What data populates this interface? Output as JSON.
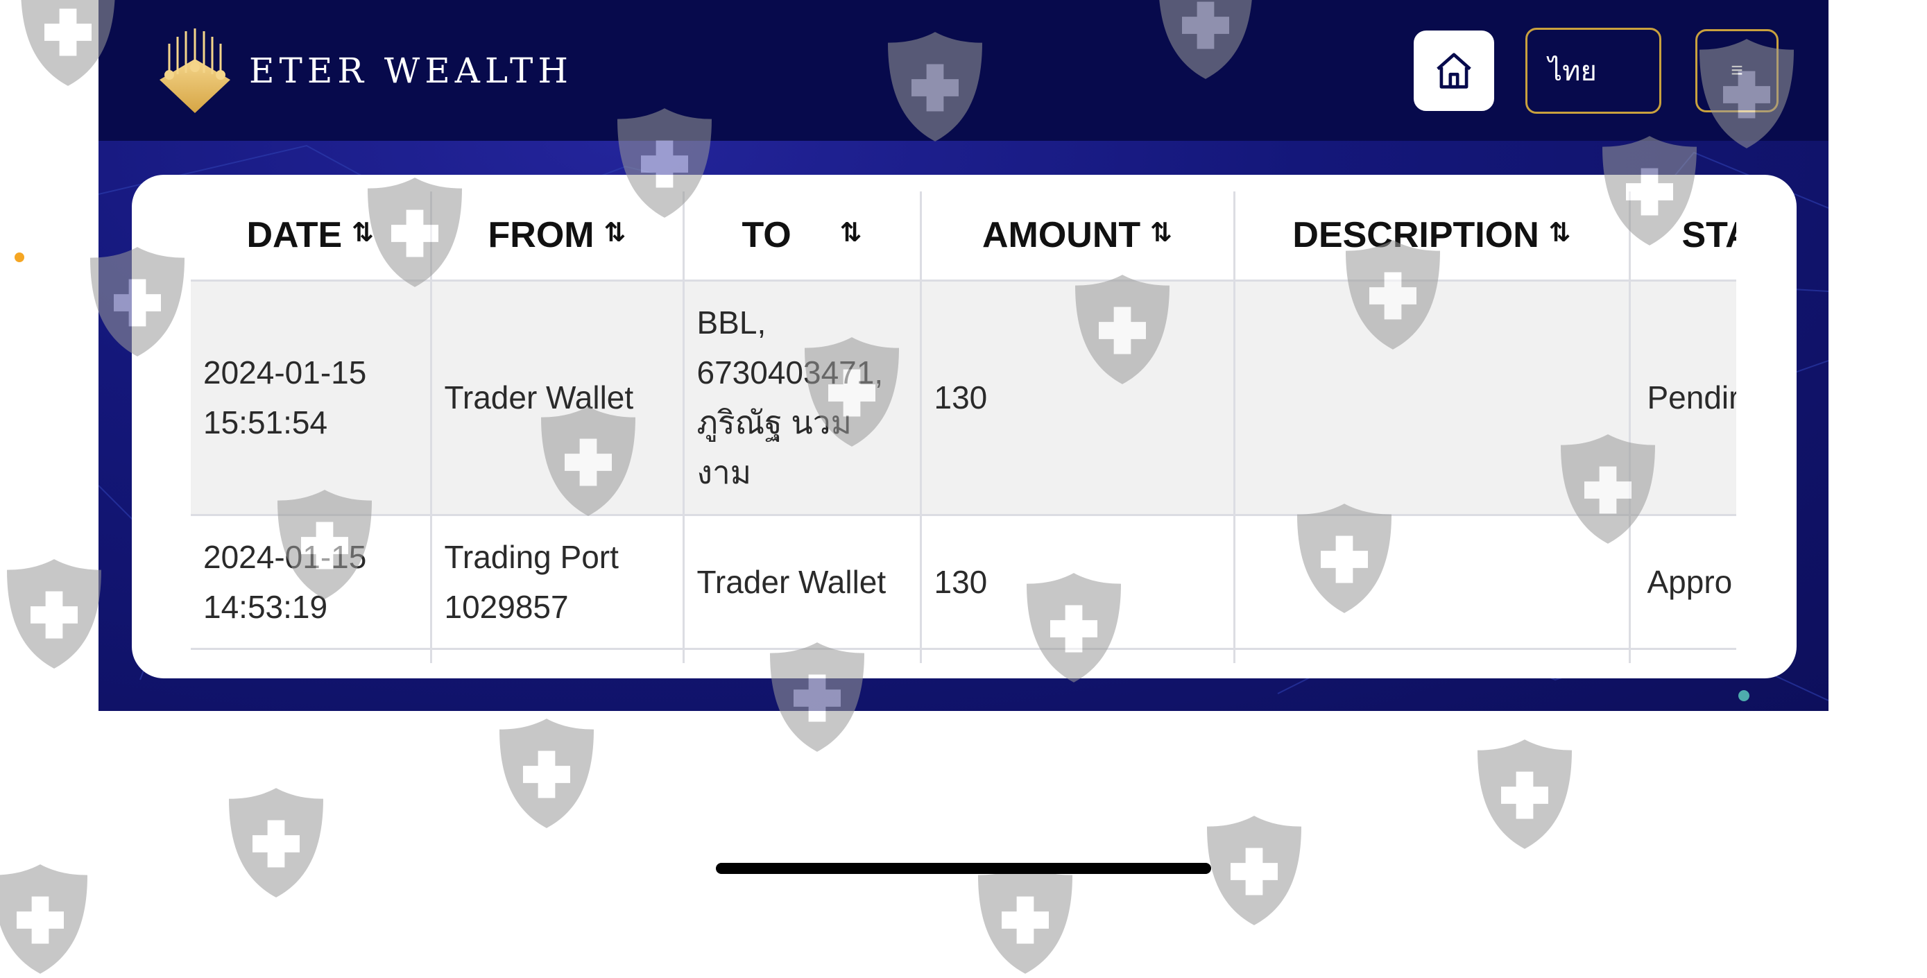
{
  "header": {
    "brand_name": "ETER WEALTH",
    "language_label": "ไทย",
    "menu_label": "≡"
  },
  "table": {
    "columns": [
      {
        "label": "DATE",
        "sort_icon": "⇅"
      },
      {
        "label": "FROM",
        "sort_icon": "⇅"
      },
      {
        "label": "TO",
        "sort_icon": "⇅"
      },
      {
        "label": "AMOUNT",
        "sort_icon": "⇅"
      },
      {
        "label": "DESCRIPTION",
        "sort_icon": "⇅"
      },
      {
        "label": "STA",
        "sort_icon": ""
      }
    ],
    "rows": [
      {
        "date": "2024-01-15 15:51:54",
        "from": "Trader Wallet",
        "to": "BBL, 6730403471, ภูริณัฐ นวม งาม",
        "amount": "130",
        "description": "",
        "status": "Pendir"
      },
      {
        "date": "2024-01-15 14:53:19",
        "from": "Trading Port 1029857",
        "to": "Trader Wallet",
        "amount": "130",
        "description": "",
        "status": "Appro"
      }
    ]
  },
  "icons": {
    "home": "home-icon",
    "logo": "crown-logo-icon",
    "watermark": "shield-cross-icon"
  },
  "colors": {
    "header_bg": "#070a4c",
    "page_bg": "#14177a",
    "accent_gold": "#c9a13e",
    "row_shade": "#f1f1f1"
  }
}
